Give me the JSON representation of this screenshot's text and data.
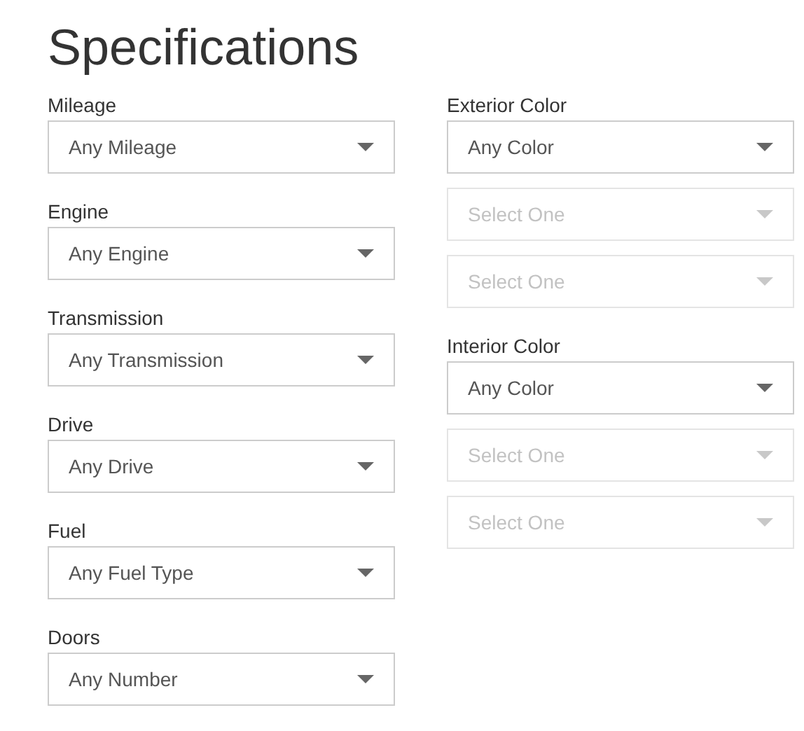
{
  "title": "Specifications",
  "left_column": [
    {
      "label": "Mileage",
      "value": "Any Mileage",
      "disabled": false
    },
    {
      "label": "Engine",
      "value": "Any Engine",
      "disabled": false
    },
    {
      "label": "Transmission",
      "value": "Any Transmission",
      "disabled": false
    },
    {
      "label": "Drive",
      "value": "Any Drive",
      "disabled": false
    },
    {
      "label": "Fuel",
      "value": "Any Fuel Type",
      "disabled": false
    },
    {
      "label": "Doors",
      "value": "Any Number",
      "disabled": false
    }
  ],
  "right_column": [
    {
      "label": "Exterior Color",
      "selects": [
        {
          "value": "Any Color",
          "disabled": false
        },
        {
          "value": "Select One",
          "disabled": true
        },
        {
          "value": "Select One",
          "disabled": true
        }
      ]
    },
    {
      "label": "Interior Color",
      "selects": [
        {
          "value": "Any Color",
          "disabled": false
        },
        {
          "value": "Select One",
          "disabled": true
        },
        {
          "value": "Select One",
          "disabled": true
        }
      ]
    }
  ]
}
